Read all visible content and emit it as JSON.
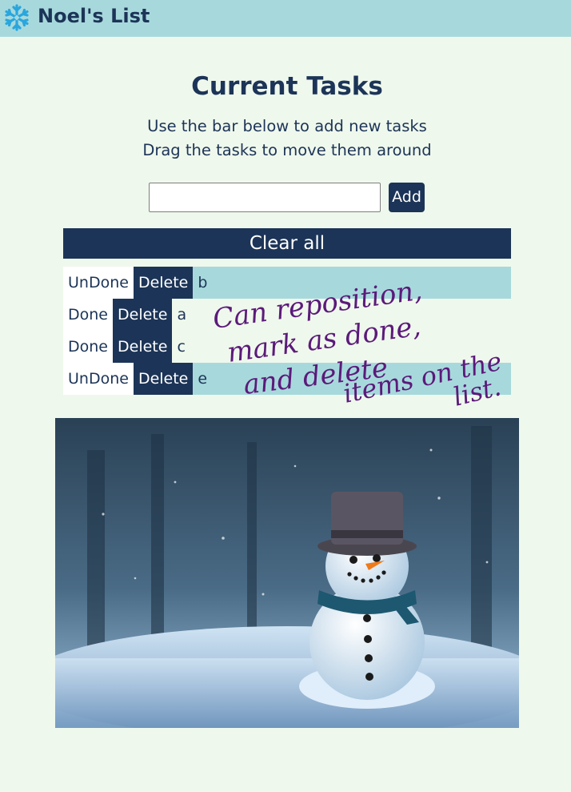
{
  "app": {
    "title": "Noel's List",
    "logo_icon": "snowflake-icon",
    "brand_color": "#1c3457",
    "header_color": "#a7d9dc"
  },
  "main": {
    "heading": "Current Tasks",
    "subtitle_1": "Use the bar below to add new tasks",
    "subtitle_2": "Drag the tasks to move them around",
    "input": {
      "value": "",
      "placeholder": ""
    },
    "add_label": "Add",
    "clear_label": "Clear all"
  },
  "tasks": [
    {
      "status": "UnDone",
      "delete_label": "Delete",
      "text": "b",
      "state": "undone"
    },
    {
      "status": "Done",
      "delete_label": "Delete",
      "text": "a",
      "state": "done"
    },
    {
      "status": "Done",
      "delete_label": "Delete",
      "text": "c",
      "state": "done"
    },
    {
      "status": "UnDone",
      "delete_label": "Delete",
      "text": "e",
      "state": "undone"
    }
  ],
  "annotation": {
    "lines": [
      "Can reposition,",
      "mark as done,",
      "and delete",
      "items on the",
      "list."
    ],
    "color": "#5b1a7a"
  },
  "image": {
    "subject": "snowman-in-snow-photo"
  }
}
